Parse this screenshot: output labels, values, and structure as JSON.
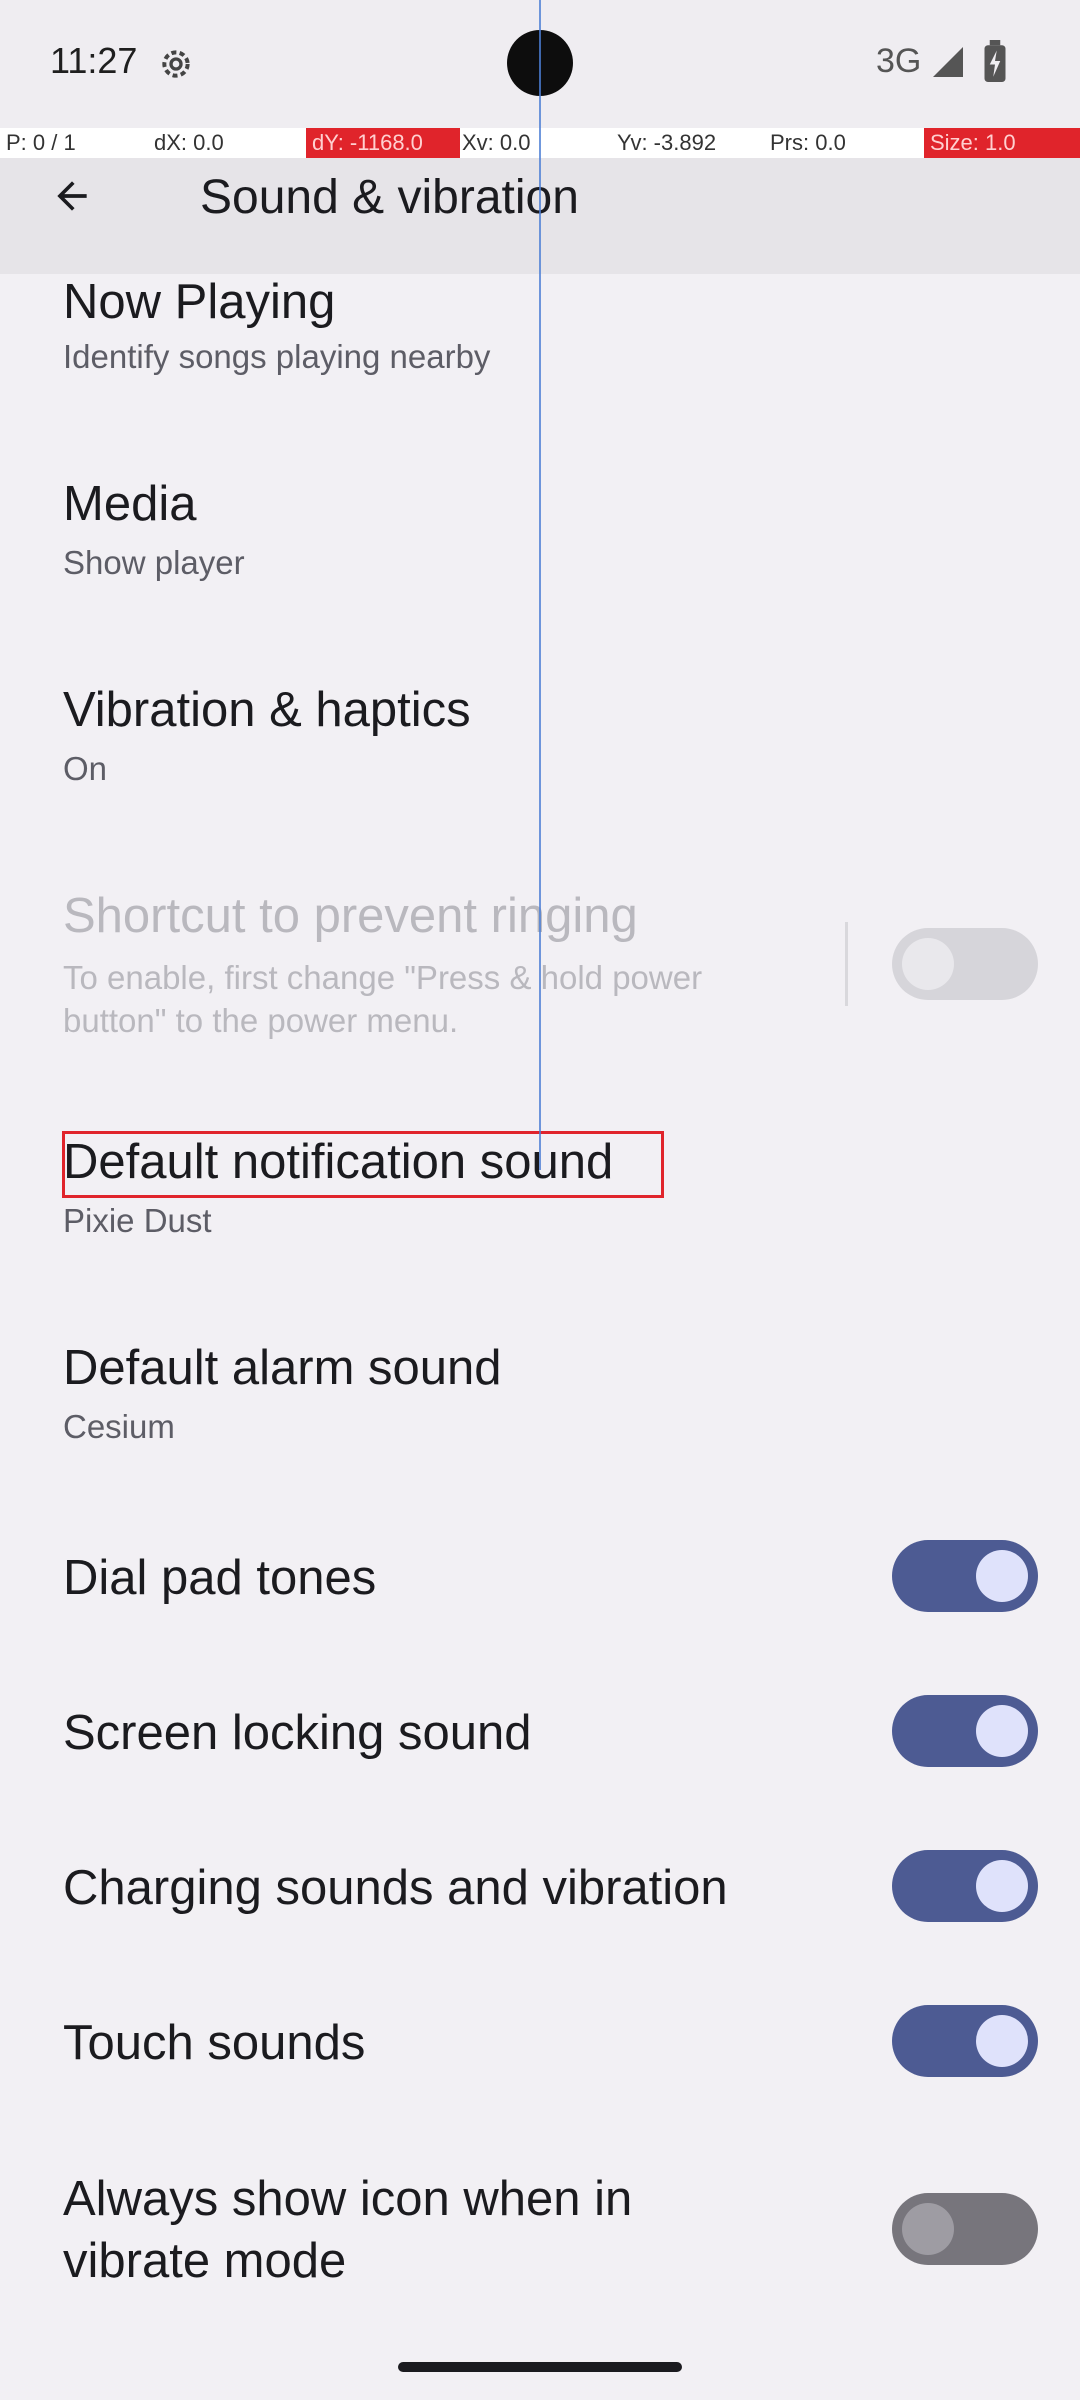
{
  "status_bar": {
    "time": "11:27",
    "network": "3G",
    "icons": [
      "settings-gear-icon",
      "signal-icon",
      "battery-icon"
    ]
  },
  "debug_bar": {
    "p": "P: 0 / 1",
    "dx": "dX: 0.0",
    "dy": "dY: -1168.0",
    "xv": "Xv: 0.0",
    "yv": "Yv: -3.892",
    "prs": "Prs: 0.0",
    "size": "Size: 1.0"
  },
  "app_bar": {
    "title": "Sound & vibration",
    "back_icon": "arrow-back-icon"
  },
  "preferences": {
    "now_playing": {
      "title": "Now Playing",
      "summary": "Identify songs playing nearby"
    },
    "media": {
      "title": "Media",
      "summary": "Show player"
    },
    "vibration": {
      "title": "Vibration & haptics",
      "summary": "On"
    },
    "shortcut": {
      "title": "Shortcut to prevent ringing",
      "summary": "To enable, first change \"Press & hold power button\" to the power menu.",
      "state": "off-disabled"
    },
    "notification_sound": {
      "title": "Default notification sound",
      "summary": "Pixie Dust"
    },
    "alarm_sound": {
      "title": "Default alarm sound",
      "summary": "Cesium"
    },
    "dial_pad": {
      "title": "Dial pad tones",
      "state": "on"
    },
    "screen_lock": {
      "title": "Screen locking sound",
      "state": "on"
    },
    "charging": {
      "title": "Charging sounds and vibration",
      "state": "on"
    },
    "touch": {
      "title": "Touch sounds",
      "state": "on"
    },
    "vibrate_icon": {
      "title": "Always show icon when in vibrate mode",
      "state": "off"
    }
  },
  "colors": {
    "switch_on_track": "#4d5b93",
    "switch_on_thumb": "#dfe2fb",
    "highlight": "#e0242b",
    "guide_line": "#4c7ed4"
  }
}
